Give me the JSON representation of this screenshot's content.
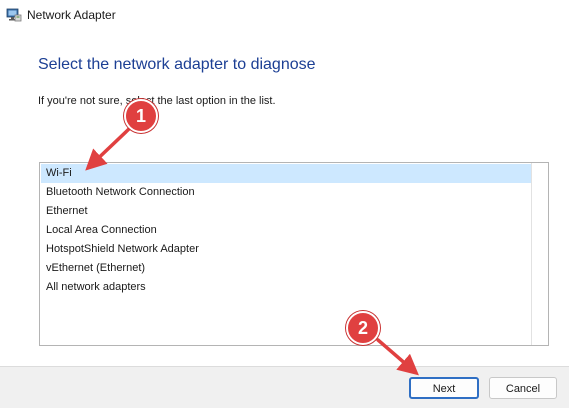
{
  "window": {
    "title": "Network Adapter",
    "icon": "network-adapter-icon"
  },
  "main": {
    "heading": "Select the network adapter to diagnose",
    "instruction": "If you're not sure, select the last option in the list.",
    "adapters": [
      {
        "label": "Wi-Fi",
        "selected": true
      },
      {
        "label": "Bluetooth Network Connection",
        "selected": false
      },
      {
        "label": "Ethernet",
        "selected": false
      },
      {
        "label": "Local Area Connection",
        "selected": false
      },
      {
        "label": "HotspotShield Network Adapter",
        "selected": false
      },
      {
        "label": "vEthernet (Ethernet)",
        "selected": false
      },
      {
        "label": "All network adapters",
        "selected": false
      }
    ]
  },
  "footer": {
    "next_label": "Next",
    "cancel_label": "Cancel"
  },
  "annotations": {
    "step1": "1",
    "step2": "2",
    "badge_color": "#e04040"
  },
  "colors": {
    "heading": "#1c3f94",
    "selected_row": "#cde8ff",
    "default_button_border": "#2f6fc4"
  }
}
